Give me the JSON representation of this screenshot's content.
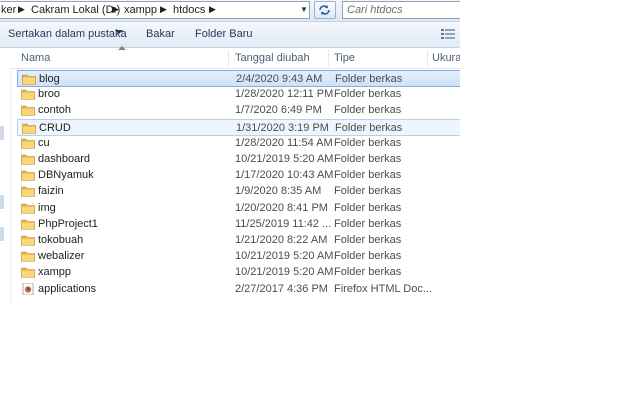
{
  "address": {
    "crumbs": [
      "ker",
      "Cakram Lokal (D:)",
      "xampp",
      "htdocs"
    ]
  },
  "search": {
    "placeholder": "Cari htdocs"
  },
  "toolbar": {
    "include_label": "Sertakan dalam pustaka",
    "burn_label": "Bakar",
    "new_folder_label": "Folder Baru"
  },
  "columns": {
    "name": "Nama",
    "date": "Tanggal diubah",
    "type": "Tipe",
    "size": "Ukuran"
  },
  "files": [
    {
      "name": "blog",
      "date": "2/4/2020 9:43 AM",
      "type": "Folder berkas",
      "kind": "folder",
      "state": "selected"
    },
    {
      "name": "broo",
      "date": "1/28/2020 12:11 PM",
      "type": "Folder berkas",
      "kind": "folder"
    },
    {
      "name": "contoh",
      "date": "1/7/2020 6:49 PM",
      "type": "Folder berkas",
      "kind": "folder"
    },
    {
      "name": "CRUD",
      "date": "1/31/2020 3:19 PM",
      "type": "Folder berkas",
      "kind": "folder",
      "state": "hover"
    },
    {
      "name": "cu",
      "date": "1/28/2020 11:54 AM",
      "type": "Folder berkas",
      "kind": "folder"
    },
    {
      "name": "dashboard",
      "date": "10/21/2019 5:20 AM",
      "type": "Folder berkas",
      "kind": "folder"
    },
    {
      "name": "DBNyamuk",
      "date": "1/17/2020 10:43 AM",
      "type": "Folder berkas",
      "kind": "folder"
    },
    {
      "name": "faizin",
      "date": "1/9/2020 8:35 AM",
      "type": "Folder berkas",
      "kind": "folder"
    },
    {
      "name": "img",
      "date": "1/20/2020 8:41 PM",
      "type": "Folder berkas",
      "kind": "folder"
    },
    {
      "name": "PhpProject1",
      "date": "11/25/2019 11:42 ...",
      "type": "Folder berkas",
      "kind": "folder"
    },
    {
      "name": "tokobuah",
      "date": "1/21/2020 8:22 AM",
      "type": "Folder berkas",
      "kind": "folder"
    },
    {
      "name": "webalizer",
      "date": "10/21/2019 5:20 AM",
      "type": "Folder berkas",
      "kind": "folder"
    },
    {
      "name": "xampp",
      "date": "10/21/2019 5:20 AM",
      "type": "Folder berkas",
      "kind": "folder"
    },
    {
      "name": "applications",
      "date": "2/27/2017 4:36 PM",
      "type": "Firefox HTML Doc...",
      "kind": "html"
    }
  ],
  "icons": {
    "folder": "folder-icon",
    "html": "firefox-html-file-icon",
    "refresh": "refresh-icon",
    "view": "view-options-icon"
  },
  "colors": {
    "selection_border": "#84acdd",
    "selection_fill": "#cfe2f8",
    "folder_yellow": "#e8c35a",
    "toolbar_text": "#1e395b"
  }
}
